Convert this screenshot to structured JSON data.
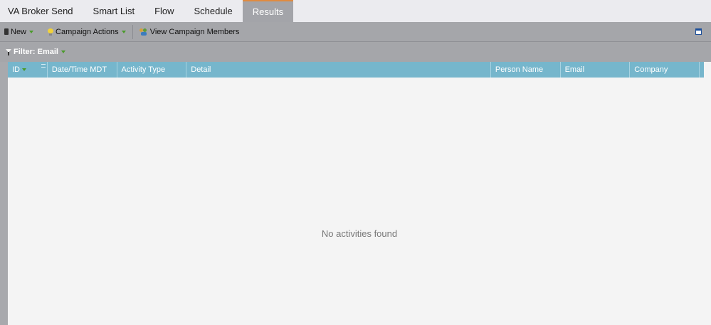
{
  "tabs": [
    {
      "label": "VA Broker Send",
      "active": false
    },
    {
      "label": "Smart List",
      "active": false
    },
    {
      "label": "Flow",
      "active": false
    },
    {
      "label": "Schedule",
      "active": false
    },
    {
      "label": "Results",
      "active": true
    }
  ],
  "toolbar": {
    "new_label": "New",
    "campaign_actions_label": "Campaign Actions",
    "view_members_label": "View Campaign Members"
  },
  "filter": {
    "label": "Filter: Email"
  },
  "grid": {
    "columns": [
      "ID",
      "Date/Time MDT",
      "Activity Type",
      "Detail",
      "Person Name",
      "Email",
      "Company"
    ],
    "empty_message": "No activities found"
  },
  "colors": {
    "tab_bar_bg": "#ebebef",
    "active_tab_bg": "#a3a4a9",
    "active_tab_accent": "#e08a40",
    "toolbar_bg": "#a5a6aa",
    "grid_header_bg": "#76b6cc",
    "body_bg": "#f4f4f4"
  },
  "icons": {
    "new": "phone-icon",
    "campaign_actions": "lightbulb-icon",
    "view_members": "members-icon",
    "filter": "filter-icon",
    "window": "window-icon"
  }
}
